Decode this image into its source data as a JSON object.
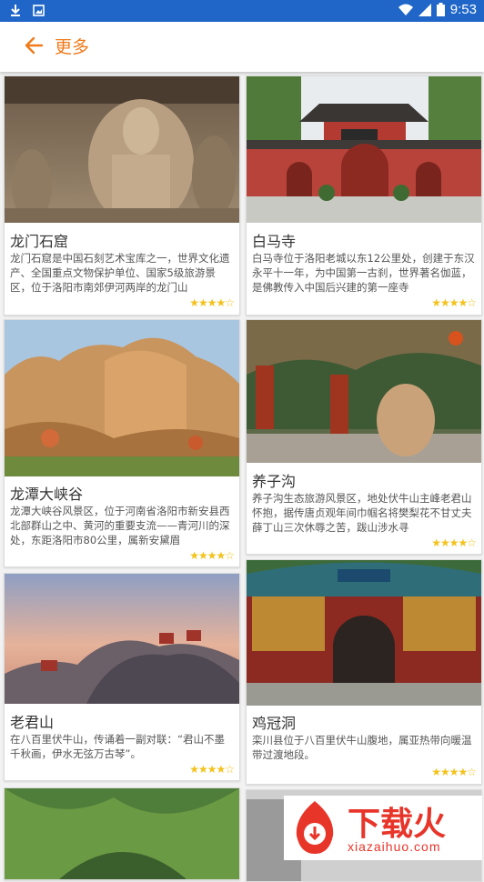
{
  "status": {
    "time": "9:53"
  },
  "header": {
    "title": "更多"
  },
  "cards": [
    {
      "name": "龙门石窟",
      "desc": "龙门石窟是中国石刻艺术宝库之一，世界文化遗产、全国重点文物保护单位、国家5级旅游景区，位于洛阳市南郊伊河两岸的龙门山",
      "stars": "★★★★☆"
    },
    {
      "name": "白马寺",
      "desc": "白马寺位于洛阳老城以东12公里处，创建于东汉永平十一年，为中国第一古刹，世界著名伽蓝，是佛教传入中国后兴建的第一座寺",
      "stars": "★★★★☆"
    },
    {
      "name": "龙潭大峡谷",
      "desc": "龙潭大峡谷风景区，位于河南省洛阳市新安县西北部群山之中、黄河的重要支流——青河川的深处，东距洛阳市80公里，属新安黛眉",
      "stars": "★★★★☆"
    },
    {
      "name": "养子沟",
      "desc": "养子沟生态旅游风景区，地处伏牛山主峰老君山怀抱，据传唐贞观年间巾帼名将樊梨花不甘丈夫薛丁山三次休辱之苦，跋山涉水寻",
      "stars": "★★★★☆"
    },
    {
      "name": "老君山",
      "desc": "在八百里伏牛山，传诵着一副对联：“君山不墨千秋画，伊水无弦万古琴”。",
      "stars": "★★★★☆"
    },
    {
      "name": "鸡冠洞",
      "desc": "栾川县位于八百里伏牛山腹地，属亚热带向暖温带过渡地段。",
      "stars": "★★★★☆"
    },
    {
      "name": "",
      "desc": "",
      "stars": ""
    },
    {
      "name": "",
      "desc": "",
      "stars": ""
    }
  ],
  "watermark": {
    "logo_text": "下载火",
    "url": "xiazaihuo.com"
  },
  "colors": {
    "statusbar": "#1f66c8",
    "accent": "#f07a1a",
    "stars": "#f3c21b"
  }
}
